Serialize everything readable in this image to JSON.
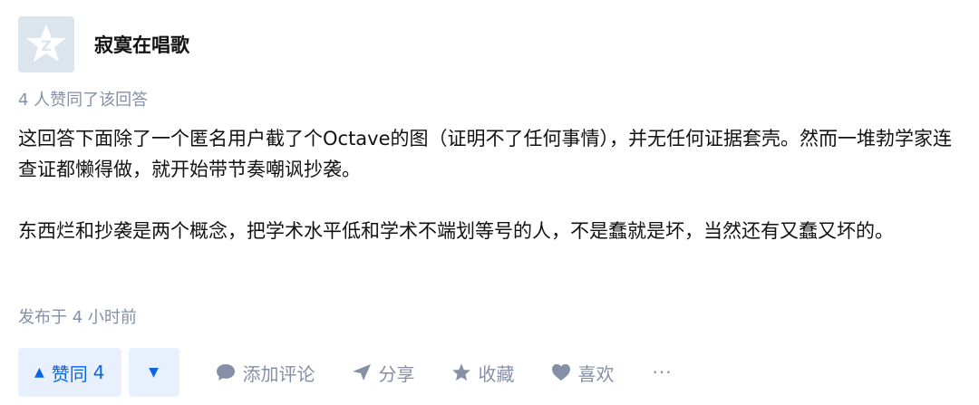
{
  "author": {
    "name": "寂寞在唱歌"
  },
  "votes_text": "4 人赞同了该回答",
  "content": {
    "paragraphs": [
      "这回答下面除了一个匿名用户截了个Octave的图（证明不了任何事情），并无任何证据套壳。然而一堆勃学家连查证都懒得做，就开始带节奏嘲讽抄袭。",
      "东西烂和抄袭是两个概念，把学术水平低和学术不端划等号的人，不是蠢就是坏，当然还有又蠢又坏的。"
    ]
  },
  "published_time": "发布于 4 小时前",
  "actions": {
    "upvote_label": "赞同",
    "upvote_count": "4",
    "comment_label": "添加评论",
    "share_label": "分享",
    "collect_label": "收藏",
    "like_label": "喜欢",
    "more_label": "···"
  },
  "colors": {
    "accent": "#0a66e0",
    "accent_bg": "#e8f0fd",
    "muted": "#8590a6"
  }
}
